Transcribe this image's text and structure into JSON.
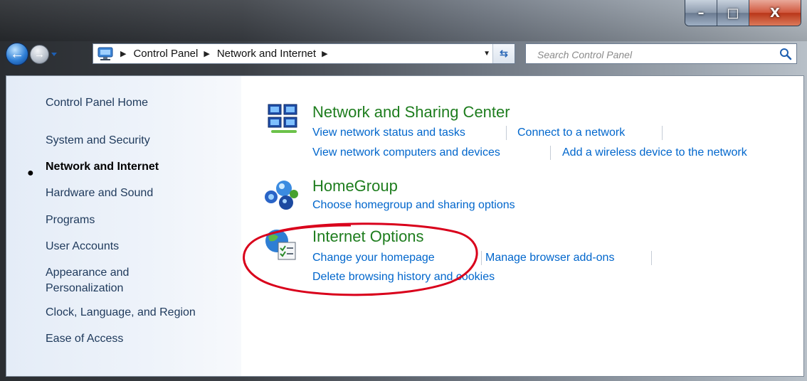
{
  "window": {
    "minimize_glyph": "–",
    "maximize_glyph": "□",
    "close_glyph": "X"
  },
  "nav": {
    "back_glyph": "←",
    "forward_glyph": "→",
    "breadcrumb": [
      "Control Panel",
      "Network and Internet"
    ],
    "search_placeholder": "Search Control Panel"
  },
  "sidebar": {
    "items": [
      {
        "label": "Control Panel Home"
      },
      {
        "label": "System and Security"
      },
      {
        "label": "Network and Internet",
        "active": true
      },
      {
        "label": "Hardware and Sound"
      },
      {
        "label": "Programs"
      },
      {
        "label": "User Accounts"
      },
      {
        "label": "Appearance and\nPersonalization"
      },
      {
        "label": "Clock, Language, and Region"
      },
      {
        "label": "Ease of Access"
      }
    ]
  },
  "main": {
    "categories": [
      {
        "title": "Network and Sharing Center",
        "icon": "network-sharing-icon",
        "links": [
          "View network status and tasks",
          "Connect to a network",
          "View network computers and devices",
          "Add a wireless device to the network"
        ]
      },
      {
        "title": "HomeGroup",
        "icon": "homegroup-icon",
        "links": [
          "Choose homegroup and sharing options"
        ]
      },
      {
        "title": "Internet Options",
        "icon": "internet-options-icon",
        "links": [
          "Change your homepage",
          "Manage browser add-ons",
          "Delete browsing history and cookies"
        ]
      }
    ]
  },
  "colors": {
    "link": "#0066cc",
    "category_title": "#1e7d1e",
    "annotation": "#d9001b"
  }
}
